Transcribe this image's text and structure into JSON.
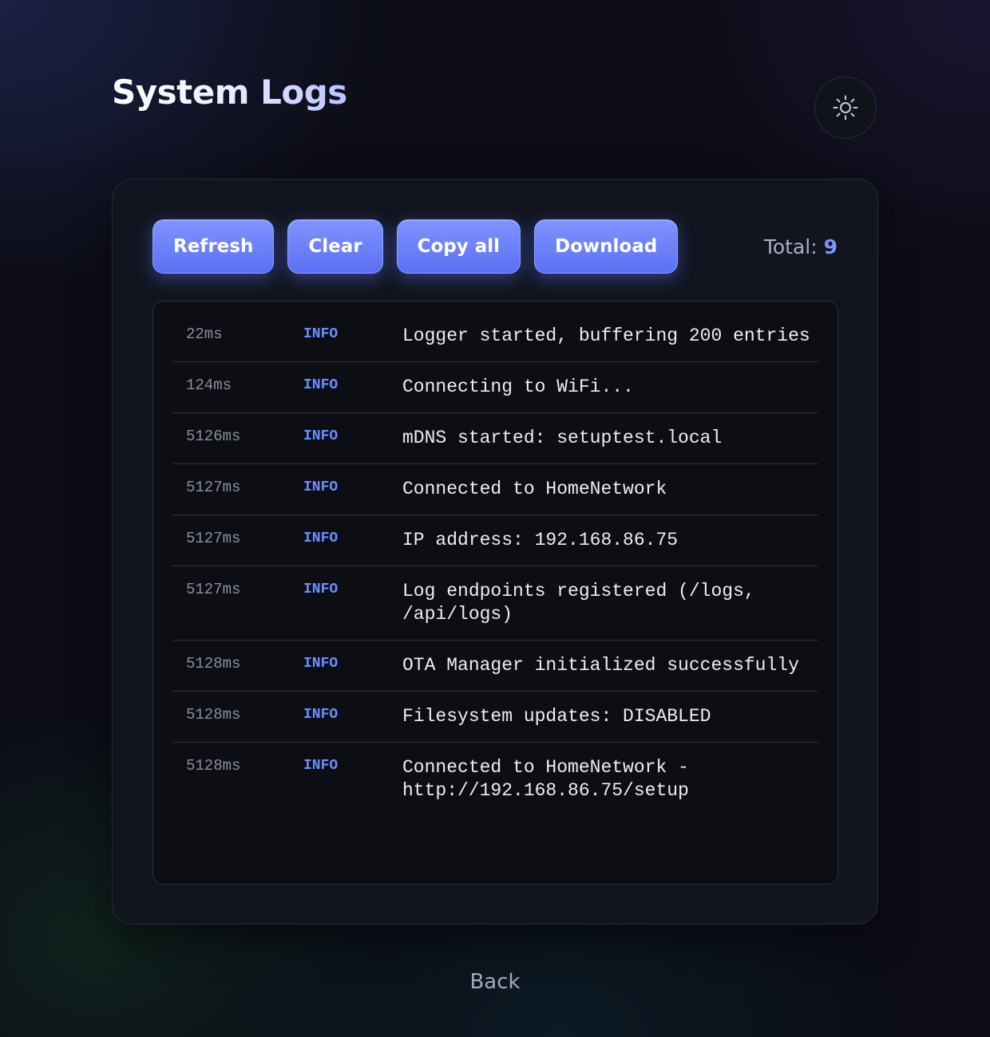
{
  "header": {
    "title": "System Logs",
    "theme_toggle_icon": "sun-icon"
  },
  "toolbar": {
    "refresh_label": "Refresh",
    "clear_label": "Clear",
    "copy_all_label": "Copy all",
    "download_label": "Download",
    "total_label": "Total:",
    "total_count": "9"
  },
  "logs": [
    {
      "time": "22ms",
      "level": "INFO",
      "message": "Logger started, buffering 200 entries"
    },
    {
      "time": "124ms",
      "level": "INFO",
      "message": "Connecting to WiFi..."
    },
    {
      "time": "5126ms",
      "level": "INFO",
      "message": "mDNS started: setuptest.local"
    },
    {
      "time": "5127ms",
      "level": "INFO",
      "message": "Connected to HomeNetwork"
    },
    {
      "time": "5127ms",
      "level": "INFO",
      "message": "IP address: 192.168.86.75"
    },
    {
      "time": "5127ms",
      "level": "INFO",
      "message": "Log endpoints registered (/logs, /api/logs)"
    },
    {
      "time": "5128ms",
      "level": "INFO",
      "message": "OTA Manager initialized successfully"
    },
    {
      "time": "5128ms",
      "level": "INFO",
      "message": "Filesystem updates: DISABLED"
    },
    {
      "time": "5128ms",
      "level": "INFO",
      "message": "Connected to HomeNetwork - http://192.168.86.75/setup"
    }
  ],
  "footer": {
    "back_label": "Back"
  },
  "colors": {
    "accent": "#6b7ff7",
    "background": "#0c0d16",
    "card": "#12151f",
    "log_panel": "#0d0e14",
    "info_level": "#6b8dff"
  }
}
